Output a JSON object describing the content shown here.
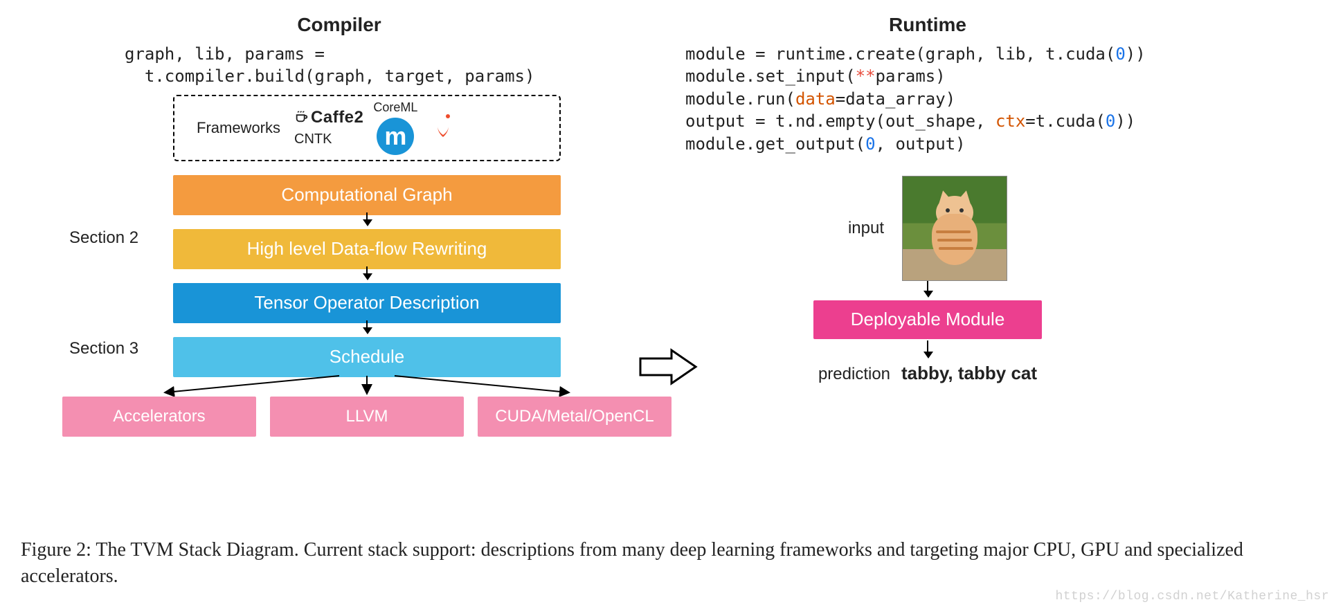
{
  "compiler": {
    "title": "Compiler",
    "code_line1": "graph, lib, params =",
    "code_line2": "  t.compiler.build(graph, target, params)",
    "frameworks": {
      "label": "Frameworks",
      "caffe2": "Caffe2",
      "cntk": "CNTK",
      "coreml": "CoreML",
      "mxnet_glyph": "m"
    },
    "section2_label": "Section 2",
    "section3_label": "Section 3",
    "block_comp_graph": "Computational Graph",
    "block_rewrite": "High level Data-flow Rewriting",
    "block_tensor_op": "Tensor Operator Description",
    "block_schedule": "Schedule",
    "targets": {
      "accel": "Accelerators",
      "llvm": "LLVM",
      "cuda": "CUDA/Metal/OpenCL"
    }
  },
  "runtime": {
    "title": "Runtime",
    "code": {
      "l1a": "module = runtime.create(graph, lib, t.cuda(",
      "l1b": "))",
      "l2a": "module.set_input(",
      "l2b": "params)",
      "l3a": "module.run(",
      "l3b": "=data_array)",
      "l4a": "output = t.nd.empty(out_shape, ",
      "l4b": "=t.cuda(",
      "l4c": "))",
      "l5": "module.get_output(",
      "l5b": ", output)",
      "kw_data": "data",
      "kw_ctx": "ctx",
      "sym_stars": "**",
      "num_zero": "0"
    },
    "input_label": "input",
    "deploy_label": "Deployable Module",
    "prediction_label": "prediction",
    "prediction_value": "tabby, tabby cat"
  },
  "caption": "Figure 2: The TVM Stack Diagram. Current stack support: descriptions from many deep learning frameworks and targeting major CPU, GPU and specialized accelerators.",
  "watermark": "https://blog.csdn.net/Katherine_hsr"
}
